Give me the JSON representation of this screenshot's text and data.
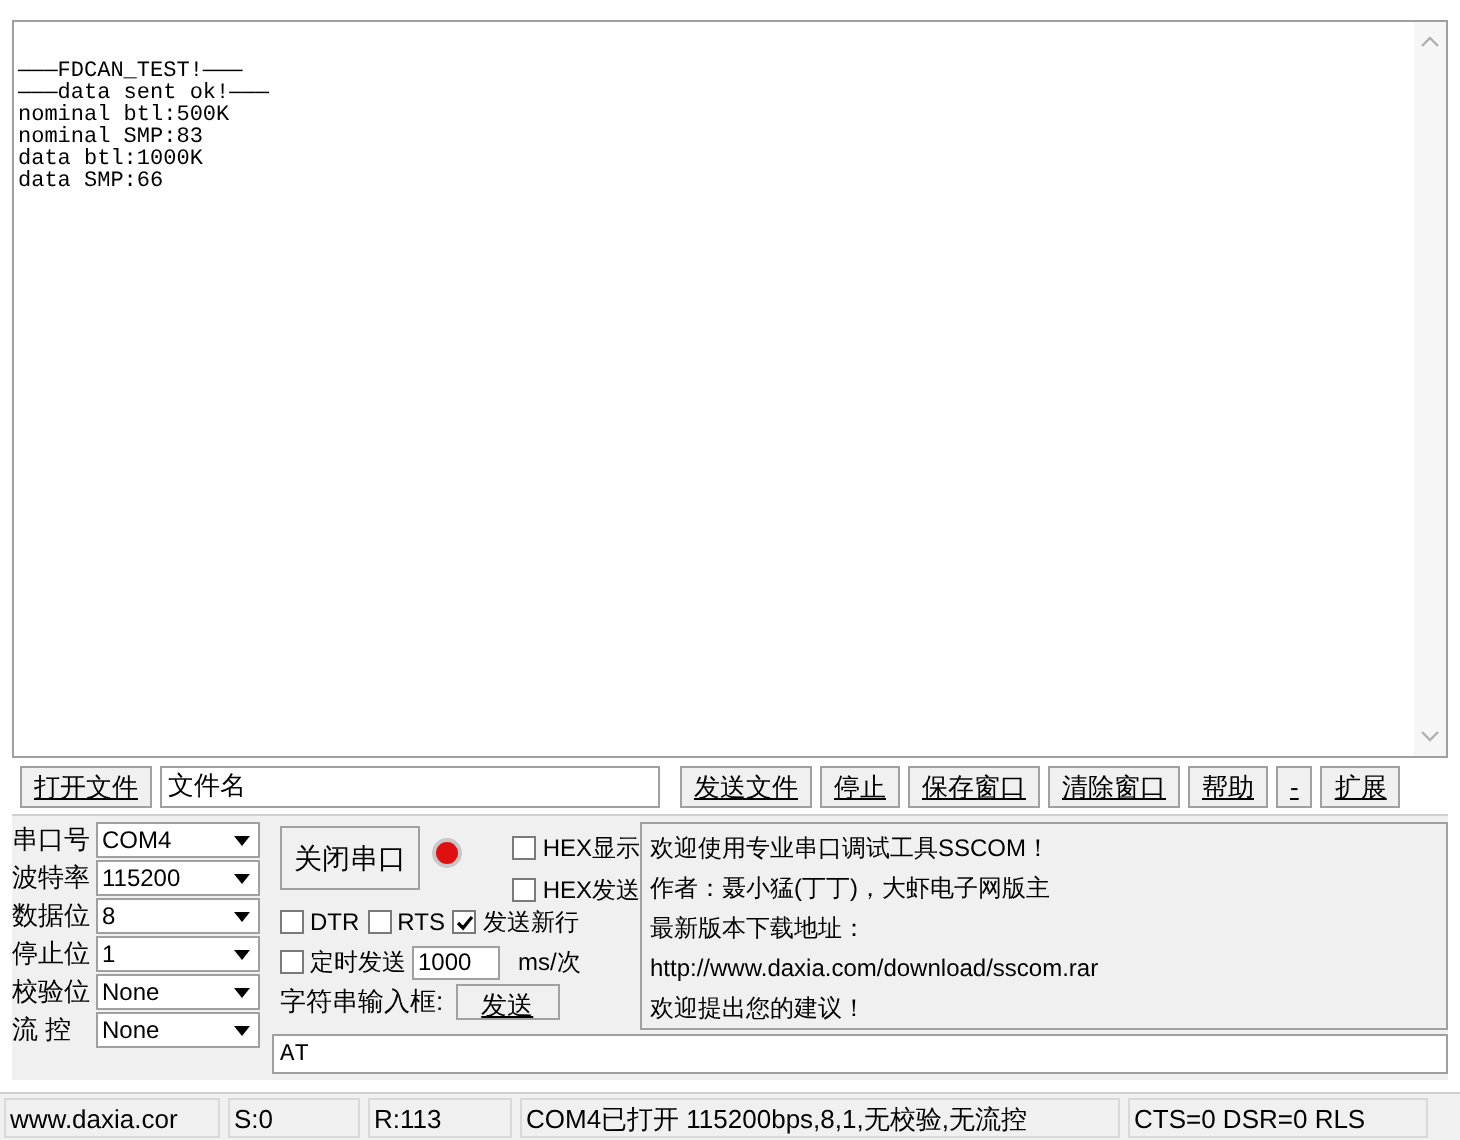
{
  "receive_area": {
    "lines": [
      "———FDCAN_TEST!———",
      "———data sent ok!———",
      "nominal btl:500K",
      "nominal SMP:83",
      "data btl:1000K",
      "data SMP:66"
    ]
  },
  "toolbar": {
    "open_file_button": "打开文件",
    "file_name_field": {
      "value": "文件名"
    },
    "buttons": [
      "发送文件",
      "停止",
      "保存窗口",
      "清除窗口",
      "帮助",
      "-",
      "扩展"
    ]
  },
  "port_settings": [
    {
      "label": "串口号",
      "value": "COM4"
    },
    {
      "label": "波特率",
      "value": "115200"
    },
    {
      "label": "数据位",
      "value": "8"
    },
    {
      "label": "停止位",
      "value": "1"
    },
    {
      "label": "校验位",
      "value": "None"
    },
    {
      "label": "流 控",
      "value": "None"
    }
  ],
  "close_port_button": "关闭串口",
  "port_open": true,
  "checkboxes": [
    {
      "label": "HEX显示",
      "checked": false
    },
    {
      "label": "HEX发送",
      "checked": false
    },
    {
      "label": "DTR",
      "checked": false
    },
    {
      "label": "RTS",
      "checked": false
    },
    {
      "label": "发送新行",
      "checked": true
    },
    {
      "label": "定时发送",
      "checked": false
    }
  ],
  "interval": {
    "value": "1000",
    "unit": "ms/次"
  },
  "string_input_label": "字符串输入框:",
  "send_button": "发送",
  "info_lines": [
    "欢迎使用专业串口调试工具SSCOM！",
    "作者：聂小猛(丁丁)，大虾电子网版主",
    "最新版本下载地址：",
    "http://www.daxia.com/download/sscom.rar",
    "欢迎提出您的建议！"
  ],
  "send_field": {
    "value": "AT"
  },
  "status_bar": [
    "www.daxia.cor",
    "S:0",
    "R:113",
    "COM4已打开  115200bps,8,1,无校验,无流控",
    "CTS=0 DSR=0 RLS"
  ]
}
